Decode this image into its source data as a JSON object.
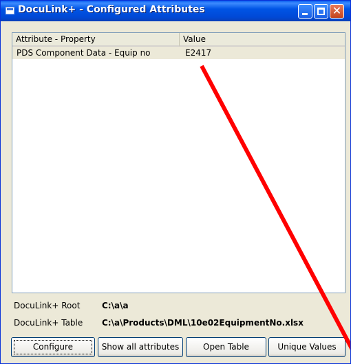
{
  "window": {
    "title": "DocuLink+ - Configured Attributes",
    "icon": "app-icon",
    "controls": {
      "minimize": "minimize-icon",
      "maximize": "maximize-icon",
      "close": "close-icon"
    }
  },
  "table": {
    "columns": [
      "Attribute - Property",
      "Value"
    ],
    "rows": [
      {
        "attribute": "PDS Component Data - Equip no",
        "value": "E2417"
      }
    ]
  },
  "info": {
    "root_label": "DocuLink+ Root",
    "root_value": "C:\\a\\a",
    "table_label": "DocuLink+ Table",
    "table_value": "C:\\a\\Products\\DML\\10e02EquipmentNo.xlsx"
  },
  "buttons": {
    "configure": "Configure",
    "show_all": "Show all attributes",
    "open_table": "Open Table",
    "unique_values": "Unique Values"
  },
  "colors": {
    "annotation_line": "#ff0000",
    "titlebar": "#0055e5",
    "face": "#ece9d8"
  }
}
